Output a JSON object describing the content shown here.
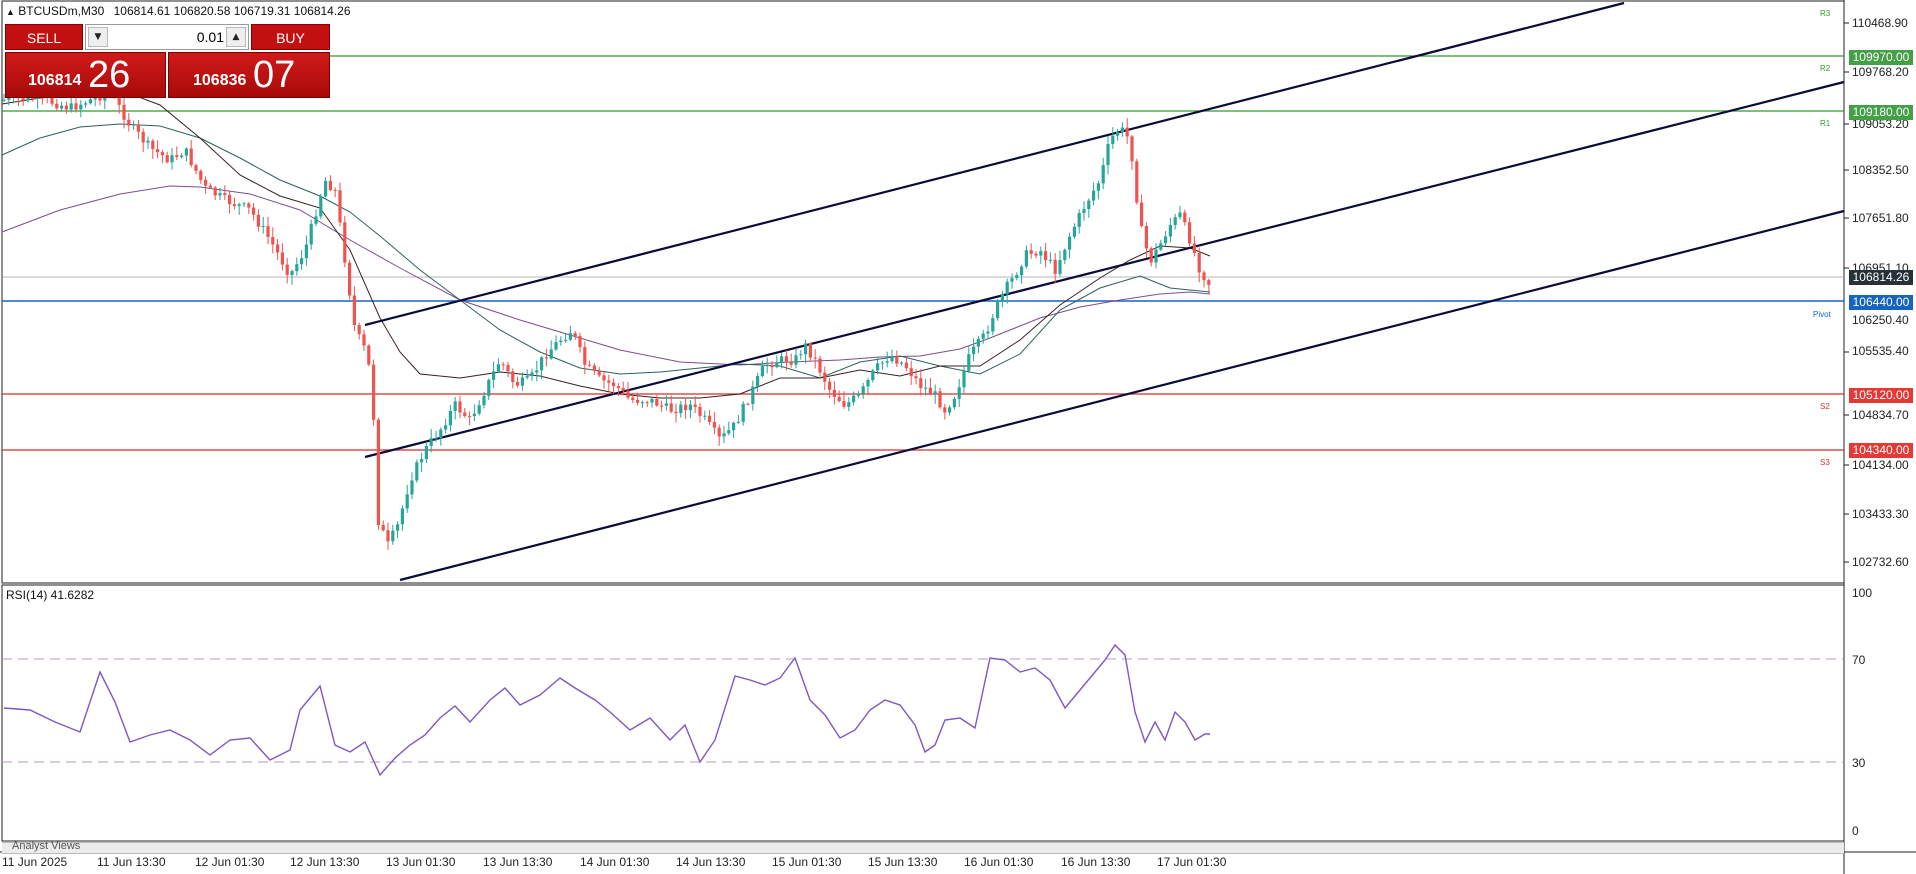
{
  "chart": {
    "symbol": "BTCUSDm,M30",
    "ohlc": "106814.61 106820.58 106719.31 106814.26",
    "current_price": "106814.26",
    "price_axis": [
      "110468.90",
      "109768.20",
      "109053.20",
      "108352.50",
      "107651.80",
      "106951.10",
      "106250.40",
      "105535.40",
      "104834.70",
      "104134.00",
      "103433.30",
      "102732.60"
    ],
    "time_axis": [
      "11 Jun 2025",
      "11 Jun 13:30",
      "12 Jun 01:30",
      "12 Jun 13:30",
      "13 Jun 01:30",
      "13 Jun 13:30",
      "14 Jun 01:30",
      "14 Jun 13:30",
      "15 Jun 01:30",
      "15 Jun 13:30",
      "16 Jun 01:30",
      "16 Jun 13:30",
      "17 Jun 01:30"
    ],
    "levels": [
      {
        "name": "R3",
        "price": "",
        "color": "#2e9b2e"
      },
      {
        "name": "R2",
        "price": "109970.00",
        "color": "#2e9b2e"
      },
      {
        "name": "R1",
        "price": "109180.00",
        "color": "#2e9b2e"
      },
      {
        "name": "Pivot",
        "price": "106440.00",
        "color": "#1565c0"
      },
      {
        "name": "S2",
        "price": "105120.00",
        "color": "#d32f2f"
      },
      {
        "name": "S3",
        "price": "104340.00",
        "color": "#d32f2f"
      }
    ],
    "colors": {
      "bull": "#26a69a",
      "bear": "#ef5350",
      "channel": "#0b0b3a",
      "rsi": "#7e57c2",
      "ma_fast": "#3a2020",
      "ma_mid": "#2f5f5f",
      "ma_slow": "#7b4f86"
    }
  },
  "trade_panel": {
    "sell_label": "SELL",
    "buy_label": "BUY",
    "lot_value": "0.01",
    "sell_price_main": "106814",
    "sell_price_pips": "26",
    "buy_price_main": "106836",
    "buy_price_pips": "07"
  },
  "rsi": {
    "title": "RSI(14) 41.6282",
    "levels": [
      "100",
      "70",
      "30",
      "0"
    ]
  },
  "bottom_tab": {
    "label": "Analyst Views"
  }
}
